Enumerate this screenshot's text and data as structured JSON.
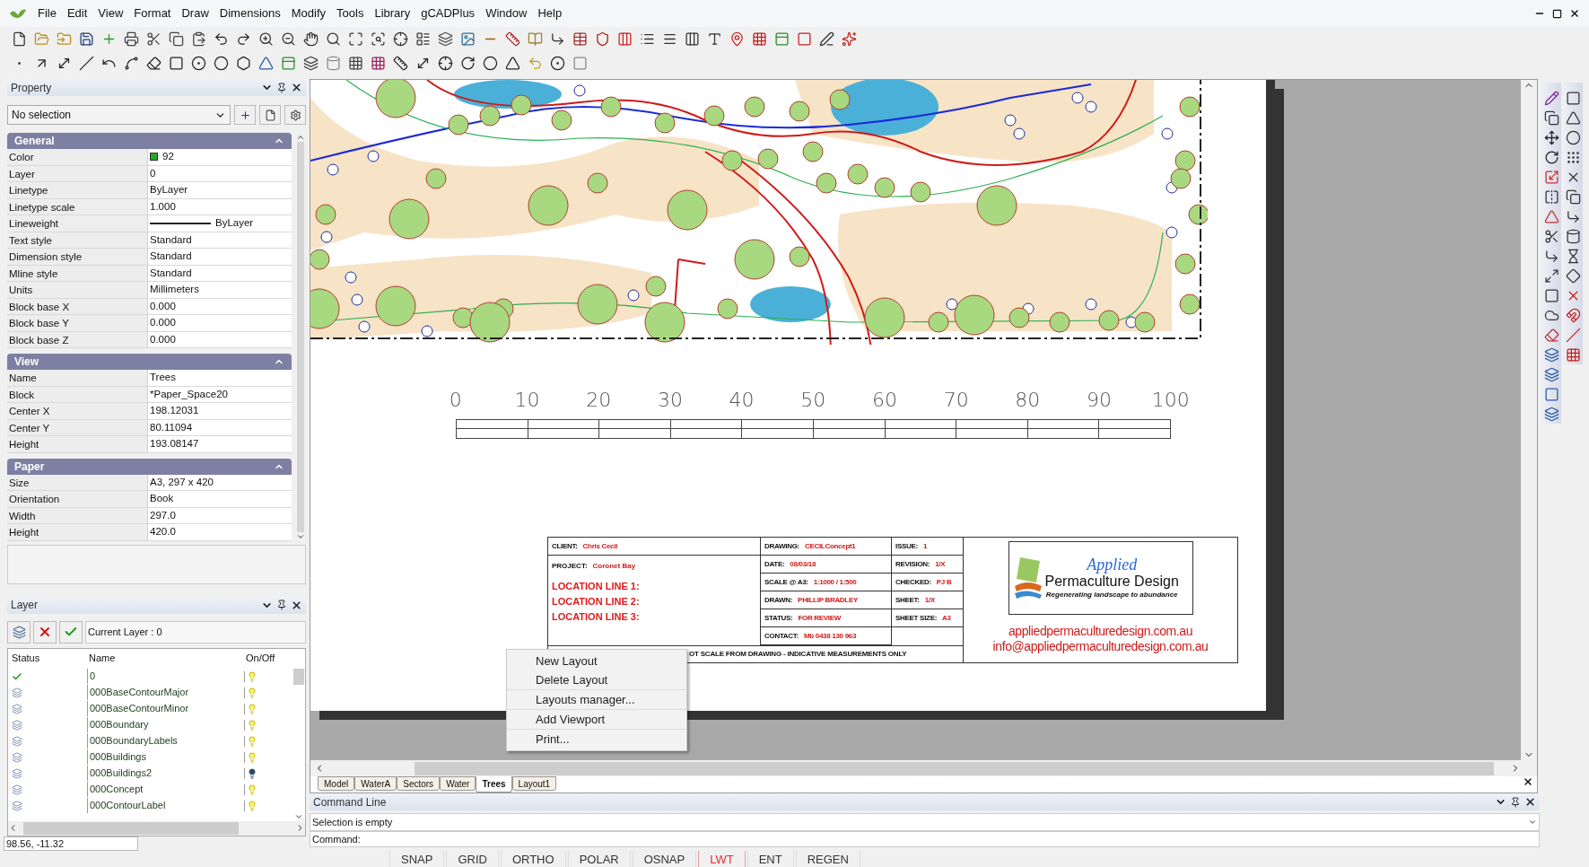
{
  "menu": [
    "File",
    "Edit",
    "View",
    "Format",
    "Draw",
    "Dimensions",
    "Modify",
    "Tools",
    "Library",
    "gCADPlus",
    "Window",
    "Help"
  ],
  "property_panel": {
    "title": "Property",
    "selection": "No selection",
    "sections": [
      {
        "title": "General",
        "rows": [
          {
            "label": "Color",
            "value": "92",
            "kind": "color",
            "color": "#22aa22"
          },
          {
            "label": "Layer",
            "value": "0",
            "kind": "text"
          },
          {
            "label": "Linetype",
            "value": "ByLayer",
            "kind": "text"
          },
          {
            "label": "Linetype scale",
            "value": "1.000",
            "kind": "text"
          },
          {
            "label": "Lineweight",
            "value": "ByLayer",
            "kind": "line"
          },
          {
            "label": "Text style",
            "value": "Standard",
            "kind": "text"
          },
          {
            "label": "Dimension style",
            "value": "Standard",
            "kind": "text"
          },
          {
            "label": "Mline style",
            "value": "Standard",
            "kind": "text"
          },
          {
            "label": "Units",
            "value": "Millimeters",
            "kind": "text"
          },
          {
            "label": "Block base X",
            "value": "0.000",
            "kind": "text"
          },
          {
            "label": "Block base Y",
            "value": "0.000",
            "kind": "text"
          },
          {
            "label": "Block base Z",
            "value": "0.000",
            "kind": "text"
          }
        ]
      },
      {
        "title": "View",
        "rows": [
          {
            "label": "Name",
            "value": "Trees",
            "kind": "text"
          },
          {
            "label": "Block",
            "value": "*Paper_Space20",
            "kind": "text"
          },
          {
            "label": "Center X",
            "value": "198.12031",
            "kind": "text"
          },
          {
            "label": "Center Y",
            "value": "80.11094",
            "kind": "text"
          },
          {
            "label": "Height",
            "value": "193.08147",
            "kind": "text"
          }
        ]
      },
      {
        "title": "Paper",
        "rows": [
          {
            "label": "Size",
            "value": "A3, 297 x 420",
            "kind": "text"
          },
          {
            "label": "Orientation",
            "value": "Book",
            "kind": "text"
          },
          {
            "label": "Width",
            "value": "297.0",
            "kind": "text"
          },
          {
            "label": "Height",
            "value": "420.0",
            "kind": "text"
          }
        ]
      }
    ]
  },
  "layer_panel": {
    "title": "Layer",
    "current_layer": "Current Layer : 0",
    "columns": [
      "Status",
      "Name",
      "On/Off"
    ],
    "rows": [
      {
        "name": "0",
        "current": true,
        "on": true
      },
      {
        "name": "000BaseContourMajor",
        "current": false,
        "on": true
      },
      {
        "name": "000BaseContourMinor",
        "current": false,
        "on": true
      },
      {
        "name": "000Boundary",
        "current": false,
        "on": true
      },
      {
        "name": "000BoundaryLabels",
        "current": false,
        "on": true
      },
      {
        "name": "000Buildings",
        "current": false,
        "on": true
      },
      {
        "name": "000Buildings2",
        "current": false,
        "on": false
      },
      {
        "name": "000Concept",
        "current": false,
        "on": true
      },
      {
        "name": "000ContourLabel",
        "current": false,
        "on": true
      }
    ]
  },
  "coordinates": "98.56, -11.32",
  "scale_labels": [
    "0",
    "10",
    "20",
    "30",
    "40",
    "50",
    "60",
    "70",
    "80",
    "90",
    "100"
  ],
  "title_block": {
    "client": {
      "label": "CLIENT:",
      "value": "Chris Cecil"
    },
    "project": {
      "label": "PROJECT:",
      "value": "Coronet Bay"
    },
    "location_lines": [
      "LOCATION LINE 1:",
      "LOCATION LINE 2:",
      "LOCATION LINE 3:"
    ],
    "middle": [
      {
        "label": "DRAWING:",
        "value": "CECILConcept1"
      },
      {
        "label": "DATE:",
        "value": "08/03/18"
      },
      {
        "label": "SCALE @ A3:",
        "value": "1:1000 / 1:500"
      },
      {
        "label": "DRAWN:",
        "value": "PHILLIP BRADLEY"
      },
      {
        "label": "STATUS:",
        "value": "FOR REVIEW"
      },
      {
        "label": "CONTACT:",
        "value": "Mb 0438 130 963"
      }
    ],
    "right": [
      {
        "label": "ISSUE:",
        "value": "1"
      },
      {
        "label": "REVISION:",
        "value": "1/X"
      },
      {
        "label": "CHECKED:",
        "value": "PJ B"
      },
      {
        "label": "SHEET:",
        "value": "1/X"
      },
      {
        "label": "SHEET SIZE:",
        "value": "A3"
      }
    ],
    "note": "OT SCALE FROM DRAWING - INDICATIVE MEASUREMENTS ONLY",
    "logo": {
      "script": "Applied",
      "name": "Permaculture Design",
      "tagline": "Regenerating landscape to abundance"
    },
    "links": [
      "appliedpermaculturedesign.com.au",
      "info@appliedpermaculturedesign.com.au"
    ]
  },
  "layout_tabs": [
    {
      "label": "Model",
      "selected": false
    },
    {
      "label": "WaterA",
      "selected": false
    },
    {
      "label": "Sectors",
      "selected": false
    },
    {
      "label": "Water",
      "selected": false
    },
    {
      "label": "Trees",
      "selected": true
    },
    {
      "label": "Layout1",
      "selected": false
    }
  ],
  "context_menu": [
    [
      "New Layout",
      "Delete Layout"
    ],
    [
      "Layouts manager..."
    ],
    [
      "Add Viewport"
    ],
    [
      "Print..."
    ]
  ],
  "command_line": {
    "title": "Command Line",
    "history": "Selection is empty",
    "prompt": "Command:"
  },
  "status_toggles": [
    {
      "label": "SNAP",
      "on": false
    },
    {
      "label": "GRID",
      "on": false
    },
    {
      "label": "ORTHO",
      "on": false
    },
    {
      "label": "POLAR",
      "on": false
    },
    {
      "label": "OSNAP",
      "on": false
    },
    {
      "label": "LWT",
      "on": true
    },
    {
      "label": "ENT",
      "on": false
    },
    {
      "label": "REGEN",
      "on": false
    }
  ]
}
